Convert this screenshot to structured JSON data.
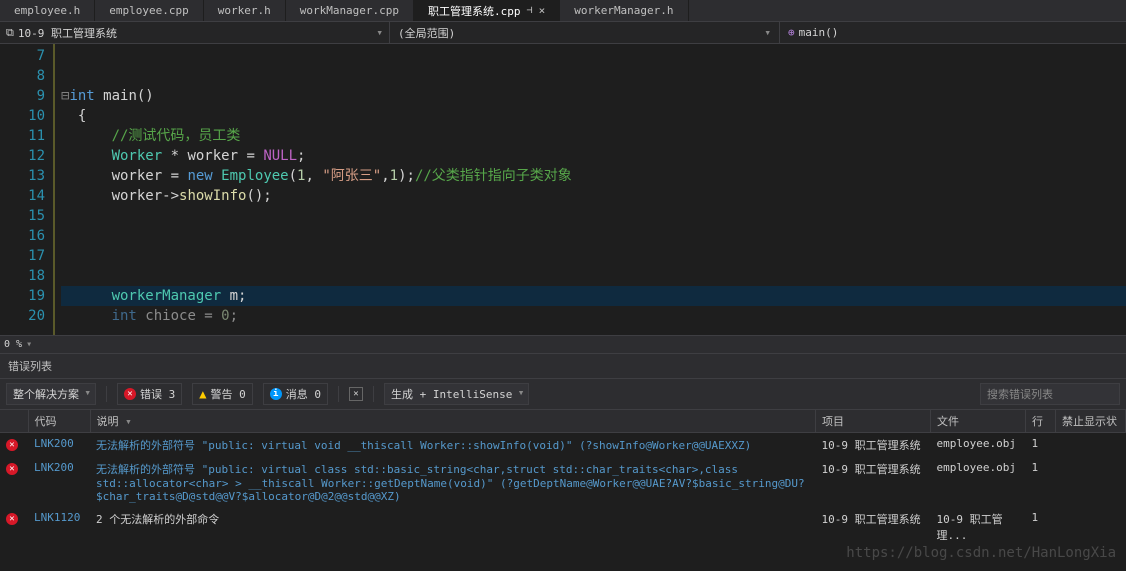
{
  "tabs": [
    {
      "label": "employee.h"
    },
    {
      "label": "employee.cpp"
    },
    {
      "label": "worker.h"
    },
    {
      "label": "workManager.cpp"
    },
    {
      "label": "职工管理系统.cpp",
      "active": true
    },
    {
      "label": "workerManager.h"
    }
  ],
  "nav": {
    "project": "10-9 职工管理系统",
    "scope": "(全局范围)",
    "function": "main()"
  },
  "code": {
    "lines": [
      "7",
      "8",
      "9",
      "10",
      "11",
      "12",
      "13",
      "14",
      "15",
      "16",
      "17",
      "18",
      "19",
      "20"
    ],
    "l9_int": "int",
    "l9_main": " main()",
    "l10": "{",
    "l11_com": "//测试代码，员工类",
    "l12_cls": "Worker",
    "l12_rest": " * worker = ",
    "l12_null": "NULL",
    "l12_semi": ";",
    "l13_a": "worker = ",
    "l13_new": "new",
    "l13_sp": " ",
    "l13_cls": "Employee",
    "l13_p1": "(",
    "l13_n1": "1",
    "l13_c1": ", ",
    "l13_str": "\"阿张三\"",
    "l13_c2": ",",
    "l13_n2": "1",
    "l13_p2": ");",
    "l13_com": "//父类指针指向子类对象",
    "l14_a": "worker->",
    "l14_fn": "showInfo",
    "l14_b": "();",
    "l19_cls": "workerManager",
    "l19_rest": " m;",
    "l20_int": "int",
    "l20_rest": " chioce = ",
    "l20_n": "0",
    "l20_semi": ";"
  },
  "zoom": "0 %",
  "panel": {
    "title": "错误列表",
    "solution": "整个解决方案",
    "errors_label": "错误 3",
    "warnings_label": "警告 0",
    "messages_label": "消息 0",
    "build_label": "生成 + IntelliSense",
    "search_placeholder": "搜索错误列表"
  },
  "columns": {
    "code": "代码",
    "desc": "说明",
    "project": "项目",
    "file": "文件",
    "line": "行",
    "suppress": "禁止显示状"
  },
  "errors": [
    {
      "code": "LNK200",
      "desc": "无法解析的外部符号 \"public: virtual void __thiscall Worker::showInfo(void)\" (?showInfo@Worker@@UAEXXZ)",
      "project": "10-9 职工管理系统",
      "file": "employee.obj",
      "line": "1"
    },
    {
      "code": "LNK200",
      "desc": "无法解析的外部符号 \"public: virtual class std::basic_string<char,struct std::char_traits<char>,class std::allocator<char> > __thiscall Worker::getDeptName(void)\" (?getDeptName@Worker@@UAE?AV?$basic_string@DU?$char_traits@D@std@@V?$allocator@D@2@@std@@XZ)",
      "project": "10-9 职工管理系统",
      "file": "employee.obj",
      "line": "1"
    },
    {
      "code": "LNK1120",
      "desc": "2 个无法解析的外部命令",
      "project": "10-9 职工管理系统",
      "file": "10-9 职工管理...",
      "line": "1"
    }
  ],
  "watermark": "https://blog.csdn.net/HanLongXia"
}
